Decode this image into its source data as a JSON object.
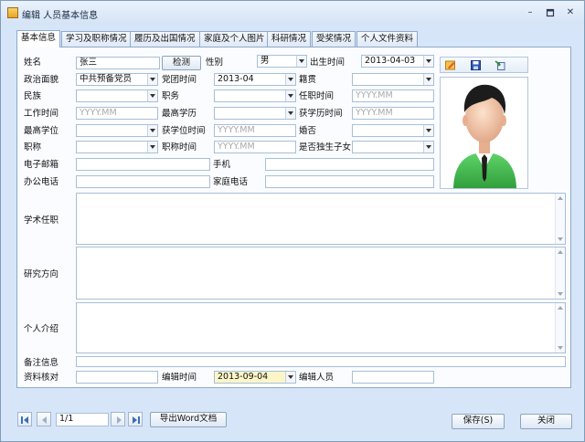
{
  "window": {
    "title": "编辑 人员基本信息"
  },
  "tabs": [
    "基本信息",
    "学习及职称情况",
    "履历及出国情况",
    "家庭及个人图片",
    "科研情况",
    "受奖情况",
    "个人文件资料"
  ],
  "active_tab": "基本信息",
  "form": {
    "name_label": "姓名",
    "name_value": "张三",
    "check_button": "检测",
    "gender_label": "性别",
    "gender_value": "男",
    "birth_label": "出生时间",
    "birth_value": "2013-04-03",
    "political_label": "政治面貌",
    "political_value": "中共预备党员",
    "party_time_label": "党团时间",
    "party_time_value": "2013-04",
    "native_label": "籍贯",
    "native_value": "",
    "ethnic_label": "民族",
    "ethnic_value": "",
    "position_label": "职务",
    "position_value": "",
    "appoint_time_label": "任职时间",
    "appoint_time_placeholder": "YYYY.MM",
    "work_time_label": "工作时间",
    "work_time_placeholder": "YYYY.MM",
    "highest_edu_label": "最高学历",
    "highest_edu_value": "",
    "edu_time_label": "获学历时间",
    "edu_time_placeholder": "YYYY.MM",
    "degree_label": "最高学位",
    "degree_value": "",
    "degree_time_label": "获学位时间",
    "degree_time_placeholder": "YYYY.MM",
    "marriage_label": "婚否",
    "marriage_value": "",
    "title_label": "职称",
    "title_value": "",
    "title_time_label": "职称时间",
    "title_time_placeholder": "YYYY.MM",
    "only_child_label": "是否独生子女",
    "only_child_value": "",
    "email_label": "电子邮箱",
    "email_value": "",
    "mobile_label": "手机",
    "mobile_value": "",
    "office_phone_label": "办公电话",
    "office_phone_value": "",
    "home_phone_label": "家庭电话",
    "home_phone_value": "",
    "academic_label": "学术任职",
    "academic_value": "",
    "research_label": "研究方向",
    "research_value": "",
    "intro_label": "个人介绍",
    "intro_value": "",
    "remark_label": "备注信息",
    "remark_value": "",
    "verify_label": "资料核对",
    "verify_value": "",
    "edit_time_label": "编辑时间",
    "edit_time_value": "2013-09-04",
    "editor_label": "编辑人员",
    "editor_value": ""
  },
  "photo_tools": [
    "edit-icon",
    "save-icon",
    "import-icon"
  ],
  "footer": {
    "record_value": "1/1",
    "export_button": "导出Word文档",
    "save_button": "保存(S)",
    "close_button": "关闭"
  },
  "colors": {
    "window_bg": "#d6e6f8",
    "highlight_field": "#fbf6c8",
    "shirt": "#3cb44a"
  }
}
